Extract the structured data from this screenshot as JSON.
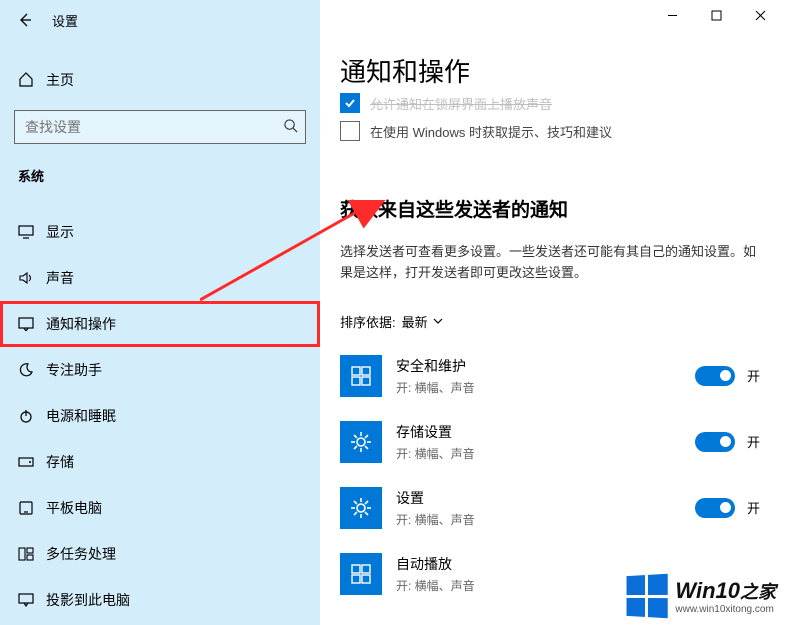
{
  "app_title": "设置",
  "window_controls": {
    "min": "—",
    "max": "□",
    "close": "✕"
  },
  "sidebar": {
    "home": "主页",
    "search_placeholder": "查找设置",
    "category": "系统",
    "items": [
      {
        "label": "显示"
      },
      {
        "label": "声音"
      },
      {
        "label": "通知和操作",
        "highlight": true
      },
      {
        "label": "专注助手"
      },
      {
        "label": "电源和睡眠"
      },
      {
        "label": "存储"
      },
      {
        "label": "平板电脑"
      },
      {
        "label": "多任务处理"
      },
      {
        "label": "投影到此电脑"
      }
    ]
  },
  "main": {
    "title": "通知和操作",
    "checkbox_hidden_label": "允许通知在锁屏界面上播放声音",
    "checkbox2_label": "在使用 Windows 时获取提示、技巧和建议",
    "section_title": "获取来自这些发送者的通知",
    "section_desc": "选择发送者可查看更多设置。一些发送者还可能有其自己的通知设置。如果是这样，打开发送者即可更改这些设置。",
    "sort_label": "排序依据:",
    "sort_value": "最新",
    "toggle_on_label": "开",
    "senders": [
      {
        "name": "安全和维护",
        "sub": "开: 横幅、声音"
      },
      {
        "name": "存储设置",
        "sub": "开: 横幅、声音"
      },
      {
        "name": "设置",
        "sub": "开: 横幅、声音"
      },
      {
        "name": "自动播放",
        "sub": "开: 横幅、声音"
      }
    ]
  },
  "watermark": {
    "brand": "Win10",
    "suffix": "之家",
    "url": "www.win10xitong.com"
  }
}
